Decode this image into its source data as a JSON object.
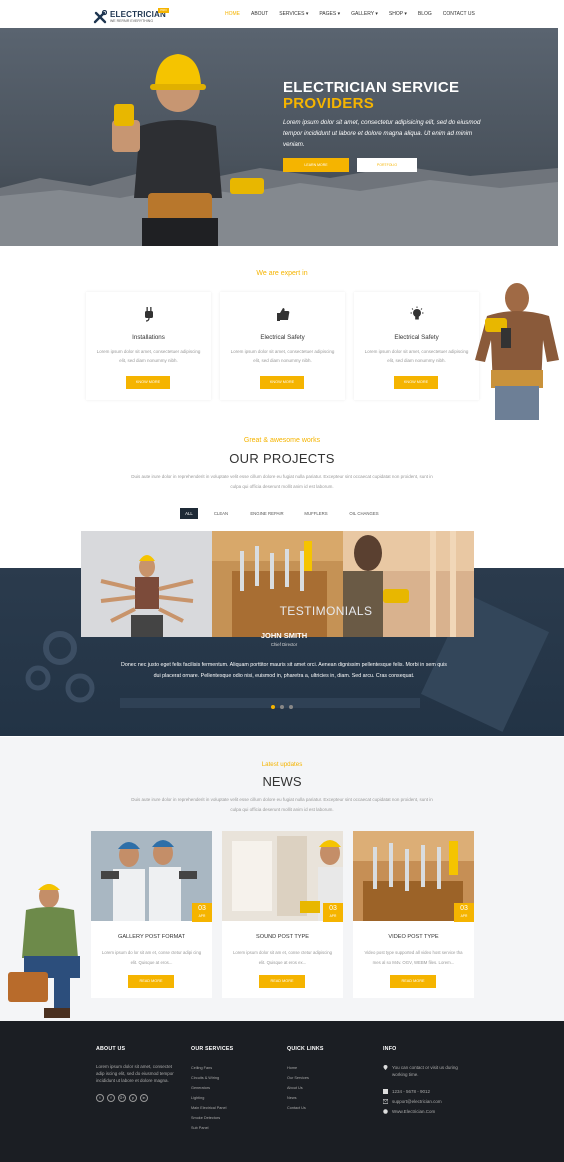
{
  "header": {
    "logo_name": "ELECTRICIAN",
    "logo_tagline": "WE REPAIR EVERYTHING",
    "logo_badge": "PRO",
    "nav": [
      "HOME",
      "ABOUT",
      "SERVICES ▾",
      "PAGES ▾",
      "GALLERY ▾",
      "SHOP ▾",
      "BLOG",
      "CONTACT US"
    ],
    "active_nav": "HOME"
  },
  "hero": {
    "title_line1": "ELECTRICIAN SERVICE",
    "title_line2": "PROVIDERS",
    "text": "Lorem ipsum dolor sit amet, consectetur adipisicing elit, sed do eiusmod tempor incididunt ut labore et dolore magna aliqua. Ut enim ad minim veniam.",
    "btn_primary": "LEARN MORE",
    "btn_secondary": "PORTFOLIO"
  },
  "expert": {
    "subtitle": "We are expert in",
    "services": [
      {
        "icon": "plug-icon",
        "title": "Installations",
        "text": "Lorem ipsum dolor sit amet, consectetuer adipiscing elit, sed diam nonummy nibh.",
        "button": "KNOW MORE"
      },
      {
        "icon": "thumbs-up-icon",
        "title": "Electrical Safety",
        "text": "Lorem ipsum dolor sit amet, consectetuer adipiscing elit, sed diam nonummy nibh.",
        "button": "KNOW MORE"
      },
      {
        "icon": "lightbulb-icon",
        "title": "Electrical Safety",
        "text": "Lorem ipsum dolor sit amet, consectetuer adipiscing elit, sed diam nonummy nibh.",
        "button": "KNOW MORE"
      }
    ]
  },
  "projects": {
    "subtitle": "Great & awesome works",
    "title": "OUR PROJECTS",
    "description": "Duis aute irure dolor in reprehenderit in voluptate velit esse cillum dolore eu fugiat nulla pariatur. Excepteur sint occaecat cupidatat non proident, sunt in culpa qui officia deserunt mollit anim id est laborum.",
    "filters": [
      "ALL",
      "CLEAN",
      "ENGINE REPAIR",
      "MUFFLERS",
      "OIL CHANGES"
    ],
    "active_filter": "ALL"
  },
  "testimonials": {
    "title": "TESTIMONIALS",
    "name": "JOHN SMITH",
    "role": "Chief Director",
    "quote": "Donec nec justo eget felis facilisis fermentum. Aliquam porttitor mauris sit amet orci. Aenean dignissim pellentesque felis. Morbi in sem quis dui placerat ornare. Pellentesque odio nisi, euismod in, pharetra a, ultricies in, diam. Sed arcu. Cras consequat."
  },
  "news": {
    "subtitle": "Latest updates",
    "title": "NEWS",
    "description": "Duis aute irure dolor in reprehenderit in voluptate velit esse cillum dolore eu fugiat nulla pariatur. Excepteur sint occaecat cupidatat non proident, sunt in culpa qui officia deserunt mollit anim id est laborum.",
    "posts": [
      {
        "day": "03",
        "month": "APR",
        "title": "GALLERY POST FORMAT",
        "text": "Lorem ipsum do lor sit am et, conse ctetur adipi cing elit. Quisque at eros...",
        "button": "READ MORE"
      },
      {
        "day": "03",
        "month": "APR",
        "title": "SOUND POST TYPE",
        "text": "Lorem ipsum dolor sit am et, conse ctetur adipiscing elit. Quisque at eros ex...",
        "button": "READ MORE"
      },
      {
        "day": "03",
        "month": "APR",
        "title": "VIDEO POST TYPE",
        "text": "Video post type supported all video host service tha mes al so M4v. OGV, WEBM files. Lorem...",
        "button": "READ MORE"
      }
    ]
  },
  "footer": {
    "about_heading": "ABOUT US",
    "about_text": "Lorem ipsum dolor sit amet, consectet adip iscing elit, sed do eiusmod tempor incididunt ut labore et dolore magna.",
    "social": [
      "t",
      "f",
      "G+",
      "p",
      "in"
    ],
    "services_heading": "OUR SERVICES",
    "services": [
      "Ceiling Fans",
      "Circuits & Wiring",
      "Generators",
      "Lighting",
      "Main Electrical Panel",
      "Smoke Detectors",
      "Sub Panel"
    ],
    "links_heading": "QUICK LINKS",
    "links": [
      "Home",
      "Our Services",
      "About Us",
      "News",
      "Contact Us"
    ],
    "info_heading": "INFO",
    "info_address": "You can contact or visit us during working time.",
    "info_phone": "1234 - 5678 - 9012",
    "info_email": "support@electrician.com",
    "info_web": "Www.Electrician.Com"
  }
}
